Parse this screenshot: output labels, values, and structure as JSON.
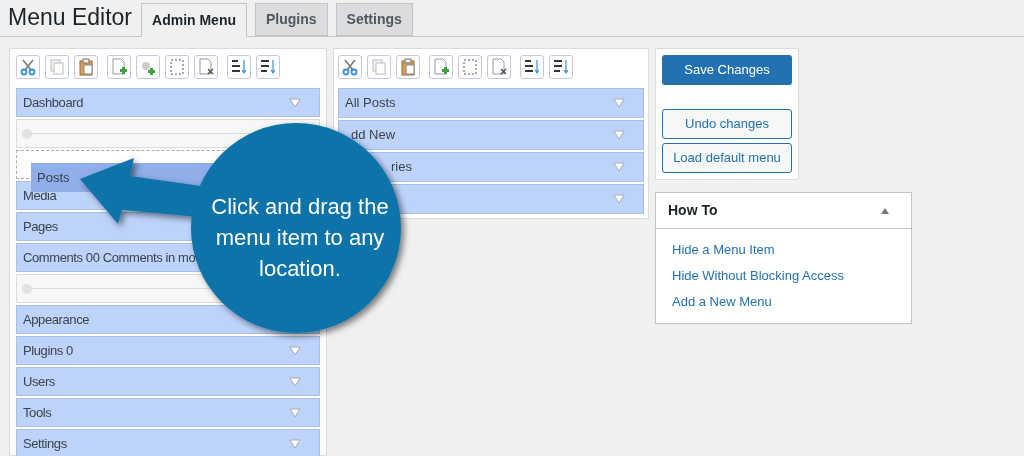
{
  "page_title": "Menu Editor",
  "tabs": [
    {
      "label": "Admin Menu",
      "selected": true
    },
    {
      "label": "Plugins",
      "selected": false
    },
    {
      "label": "Settings",
      "selected": false
    }
  ],
  "menu_column": {
    "items": [
      {
        "kind": "item",
        "label": "Dashboard",
        "caret": true
      },
      {
        "kind": "separator"
      },
      {
        "kind": "drop-placeholder"
      },
      {
        "kind": "item",
        "label": "Media",
        "caret": false
      },
      {
        "kind": "item",
        "label": "Pages",
        "caret": false
      },
      {
        "kind": "item",
        "label": "Comments 00 Comments in mo",
        "caret": false
      },
      {
        "kind": "separator"
      },
      {
        "kind": "item",
        "label": "Appearance",
        "caret": false
      },
      {
        "kind": "item",
        "label": "Plugins 0",
        "caret": true
      },
      {
        "kind": "item",
        "label": "Users",
        "caret": true
      },
      {
        "kind": "item",
        "label": "Tools",
        "caret": true
      },
      {
        "kind": "item",
        "label": "Settings",
        "caret": true
      }
    ],
    "dragged_item": {
      "label": "Posts"
    }
  },
  "submenu_column": {
    "items": [
      {
        "label": "All Posts",
        "caret": true
      },
      {
        "label": "dd New",
        "caret": true
      },
      {
        "label": "ries",
        "caret": true
      },
      {
        "caret": true
      }
    ]
  },
  "actions": {
    "primary": "Save Changes",
    "secondary": [
      "Undo changes",
      "Load default menu"
    ]
  },
  "how_to": {
    "title": "How To",
    "expanded": true,
    "links": [
      "Hide a Menu Item",
      "Hide Without Blocking Access",
      "Add a New Menu"
    ]
  },
  "callout": {
    "text": "Click and drag the menu item to any location."
  }
}
